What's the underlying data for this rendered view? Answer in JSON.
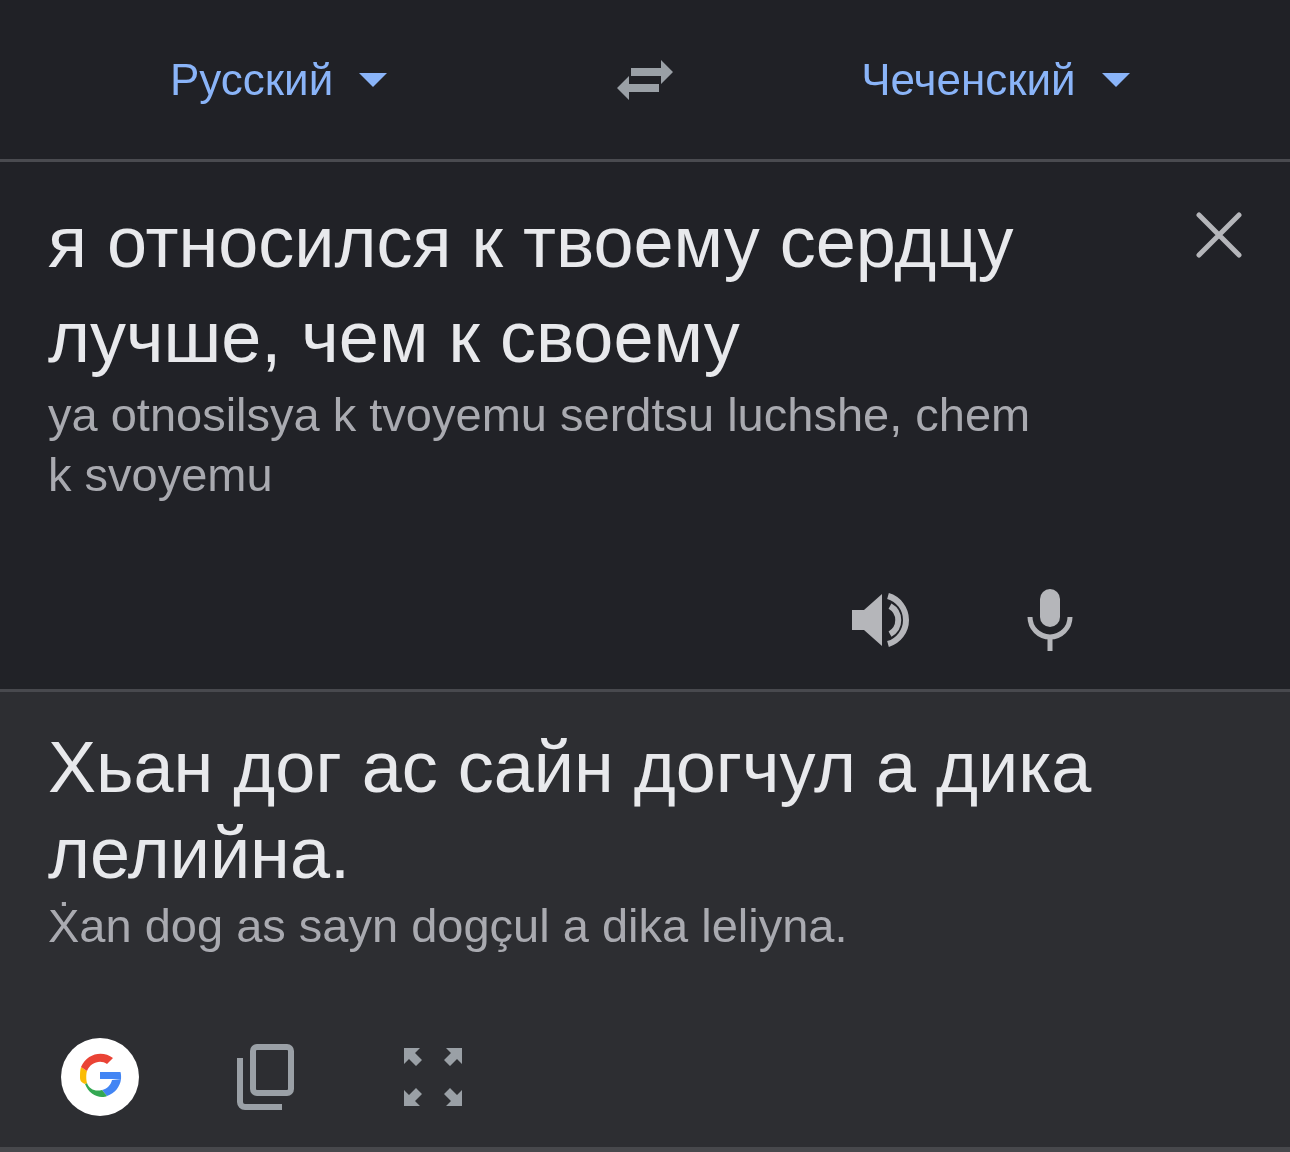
{
  "languages": {
    "source": {
      "label": "Русский"
    },
    "target": {
      "label": "Чеченский"
    }
  },
  "input": {
    "text": "я относился к твоему сердцу лучше, чем к своему",
    "transliteration": "ya otnosilsya k tvoyemu serdtsu luchshe, chem k svoyemu"
  },
  "output": {
    "text": "Хьан дог ас сайн догчул а дика лелийна.",
    "transliteration": "Ẋan dog as sayn dogçul a dika leliyna."
  }
}
